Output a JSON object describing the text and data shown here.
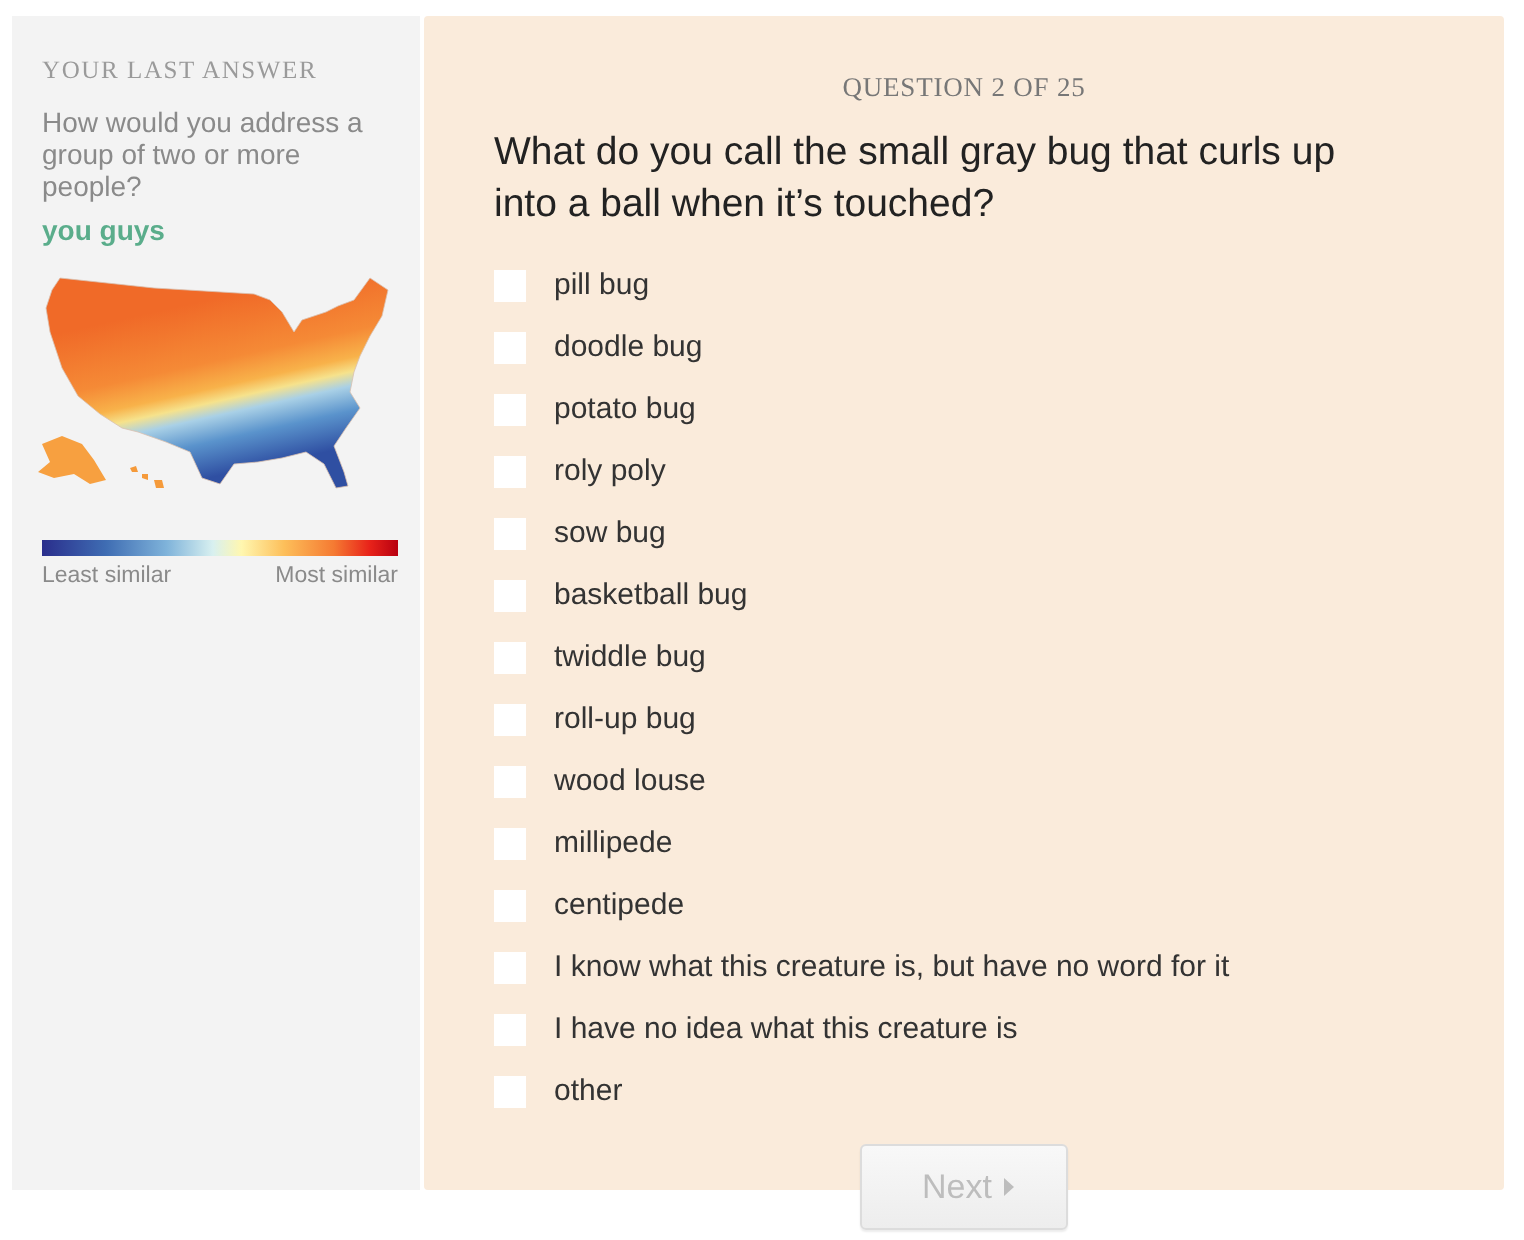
{
  "sidebar": {
    "heading": "YOUR LAST ANSWER",
    "question": "How would you address a group of two or more people?",
    "answer": "you guys",
    "legend": {
      "low_label": "Least similar",
      "high_label": "Most similar"
    }
  },
  "quiz": {
    "counter": "QUESTION 2 OF 25",
    "question": "What do you call the small gray bug that curls up into a ball when it’s touched?",
    "options": [
      {
        "label": "pill bug",
        "checked": false
      },
      {
        "label": "doodle bug",
        "checked": false
      },
      {
        "label": "potato bug",
        "checked": false
      },
      {
        "label": "roly poly",
        "checked": false
      },
      {
        "label": "sow bug",
        "checked": false
      },
      {
        "label": "basketball bug",
        "checked": false
      },
      {
        "label": "twiddle bug",
        "checked": false
      },
      {
        "label": "roll-up bug",
        "checked": false
      },
      {
        "label": "wood louse",
        "checked": false
      },
      {
        "label": "millipede",
        "checked": false
      },
      {
        "label": "centipede",
        "checked": false
      },
      {
        "label": "I know what this creature is, but have no word for it",
        "checked": false
      },
      {
        "label": "I have no idea what this creature is",
        "checked": false
      },
      {
        "label": "other",
        "checked": false
      }
    ]
  },
  "next_button": {
    "label": "Next",
    "disabled": true
  }
}
